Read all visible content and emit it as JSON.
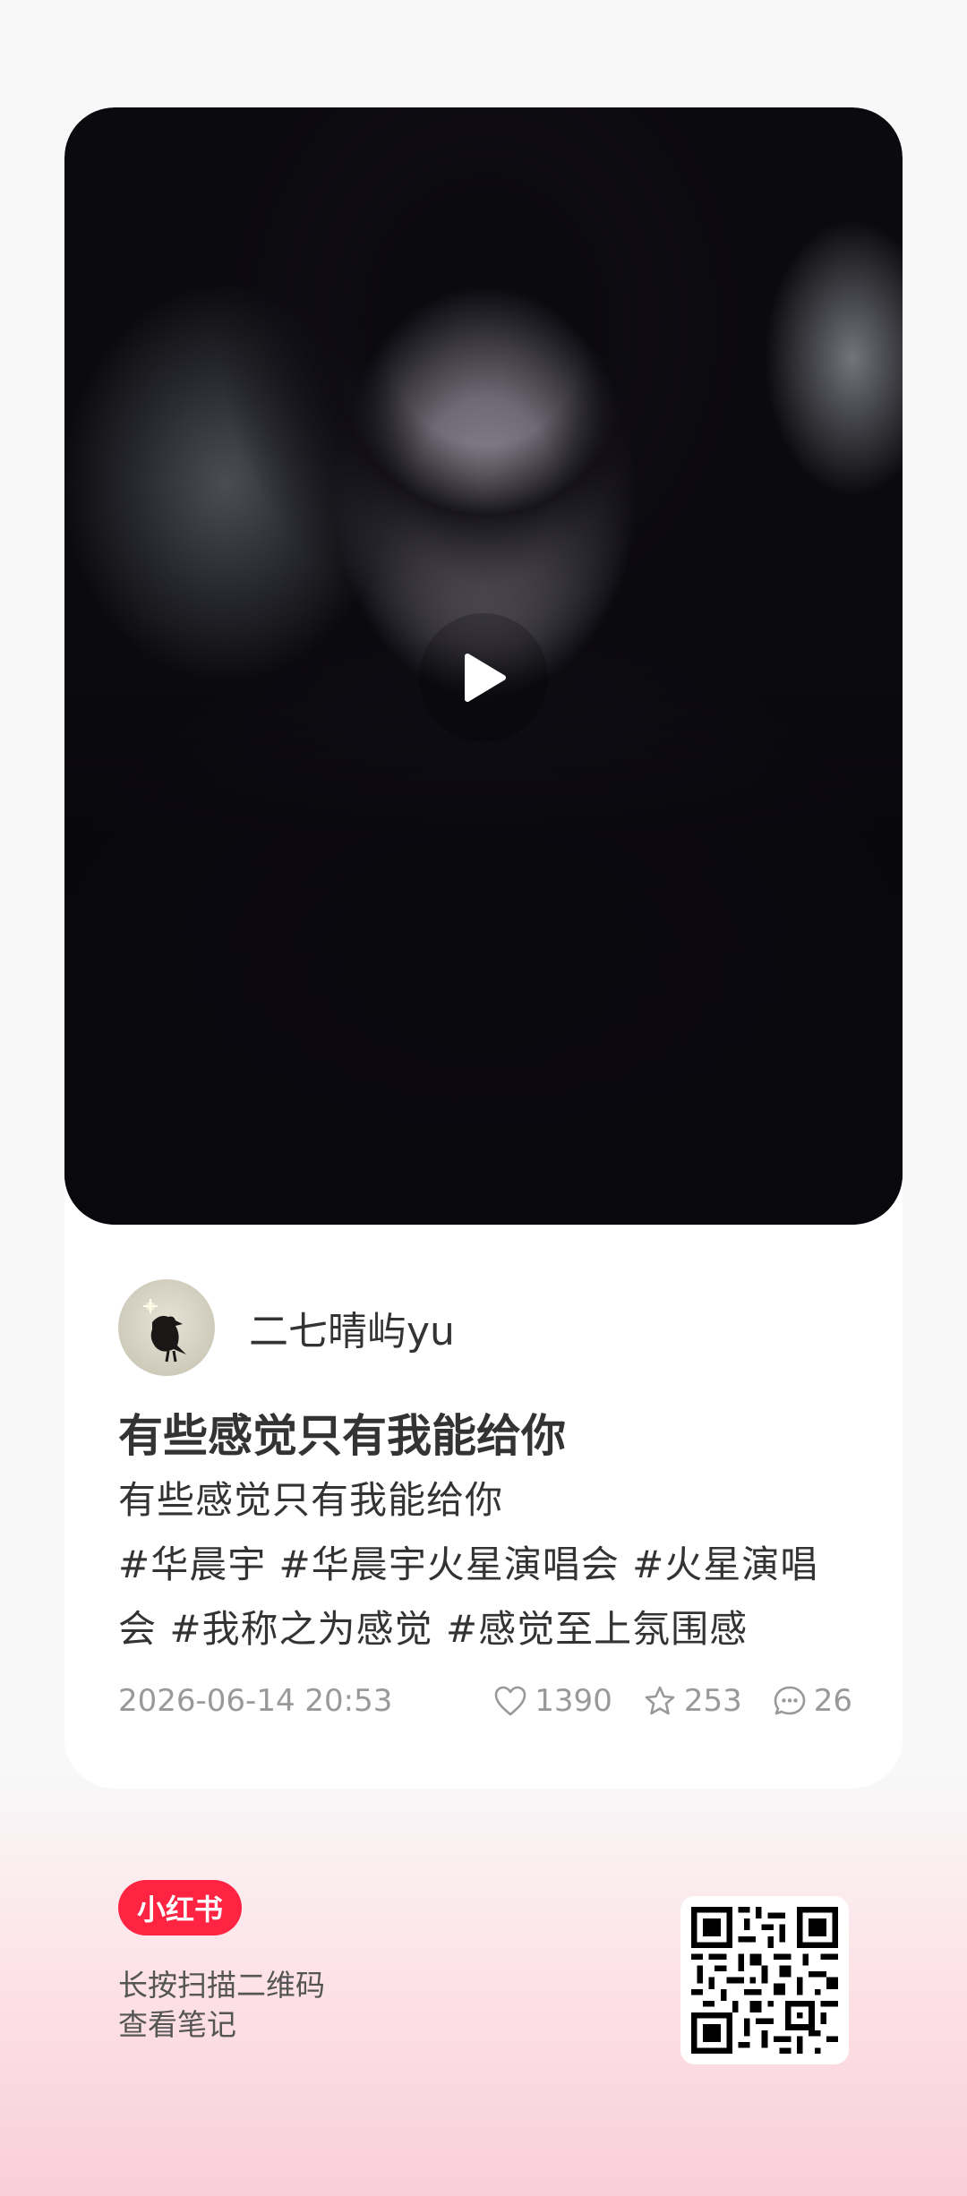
{
  "author": {
    "name": "二七晴屿yu"
  },
  "post": {
    "title": "有些感觉只有我能给你",
    "body_line1": "有些感觉只有我能给你",
    "body_tags": "#华晨宇 #华晨宇火星演唱会 #火星演唱会 #我称之为感觉 #感觉至上氛围感",
    "date": "2026-06-14 20:53",
    "likes": "1390",
    "collects": "253",
    "comments": "26",
    "media_type": "video"
  },
  "footer": {
    "logo_text": "小红书",
    "prompt_line1": "长按扫描二维码",
    "prompt_line2": "查看笔记"
  },
  "icons": {
    "play": "play-icon",
    "like": "heart-icon",
    "collect": "star-icon",
    "comment": "comment-bubble-icon"
  },
  "colors": {
    "brand": "#ff2442",
    "text_primary": "#333333",
    "text_muted": "#999999"
  }
}
